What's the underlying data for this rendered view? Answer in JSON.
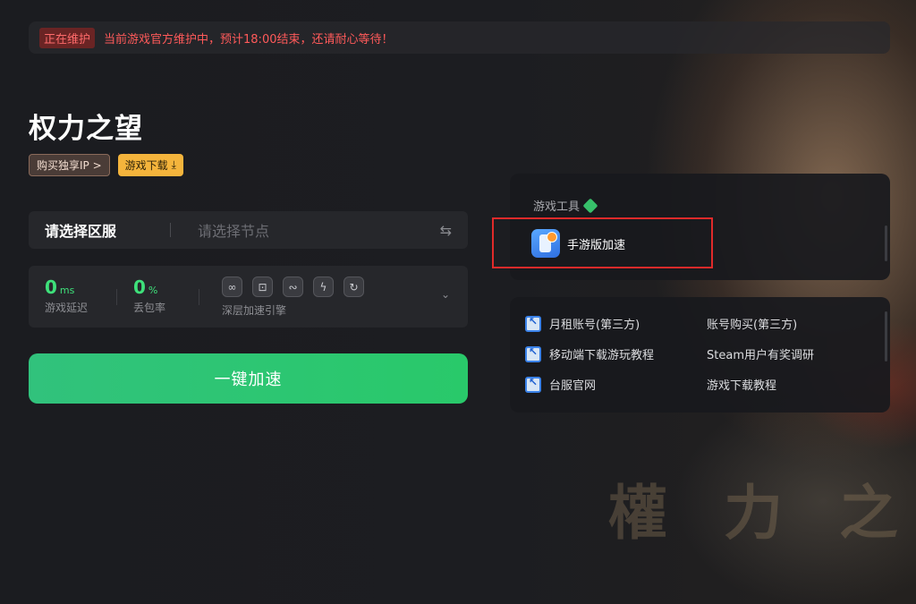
{
  "notice": {
    "badge": "正在维护",
    "text": "当前游戏官方维护中，预计18:00结束，还请耐心等待！"
  },
  "game": {
    "title": "权力之望",
    "buy_ip_label": "购买独享IP >",
    "download_label": "游戏下载",
    "bg_logo": "權 力 之 望"
  },
  "server": {
    "region_label": "请选择区服",
    "node_placeholder": "请选择节点"
  },
  "stats": {
    "latency_value": "0",
    "latency_unit": "ms",
    "latency_label": "游戏延迟",
    "loss_value": "0",
    "loss_unit": "%",
    "loss_label": "丢包率",
    "engine_label": "深层加速引擎"
  },
  "accelerate_button": "一键加速",
  "tools": {
    "title": "游戏工具",
    "items": [
      {
        "label": "手游版加速",
        "icon": "mobile-accel-icon"
      }
    ]
  },
  "links": [
    {
      "label": "月租账号(第三方)",
      "icon": "link-icon"
    },
    {
      "label": "账号购买(第三方)"
    },
    {
      "label": "移动端下载游玩教程",
      "icon": "link-icon"
    },
    {
      "label": "Steam用户有奖调研"
    },
    {
      "label": "台服官网",
      "icon": "link-icon"
    },
    {
      "label": "游戏下载教程"
    }
  ],
  "colors": {
    "accent_green": "#2fc774",
    "download_tag": "#f4b43c",
    "notice_red": "#ff5a5a",
    "highlight_border": "#e02a2a"
  }
}
